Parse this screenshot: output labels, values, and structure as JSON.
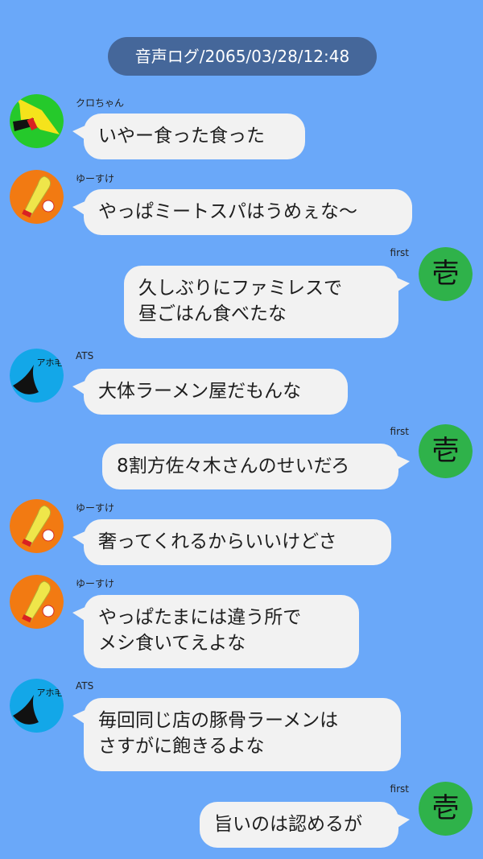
{
  "header": {
    "label": "音声ログ/2065/03/28/12:48"
  },
  "users": {
    "kuro": "クロちゃん",
    "yusuke": "ゆーすけ",
    "first": "first",
    "ats": "ATS"
  },
  "avatars": {
    "first_glyph": "壱",
    "ats_text": "アホ毛"
  },
  "messages": [
    {
      "speaker": "クロちゃん",
      "lines": [
        "いやー食った食った"
      ]
    },
    {
      "speaker": "ゆーすけ",
      "lines": [
        "やっぱミートスパはうめぇな〜"
      ]
    },
    {
      "speaker": "first",
      "lines": [
        "久しぶりにファミレスで",
        "昼ごはん食べたな"
      ]
    },
    {
      "speaker": "ATS",
      "lines": [
        "大体ラーメン屋だもんな"
      ]
    },
    {
      "speaker": "first",
      "lines": [
        "8割方佐々木さんのせいだろ"
      ]
    },
    {
      "speaker": "ゆーすけ",
      "lines": [
        "奢ってくれるからいいけどさ"
      ]
    },
    {
      "speaker": "ゆーすけ",
      "lines": [
        "やっぱたまには違う所で",
        "メシ食いてえよな"
      ]
    },
    {
      "speaker": "ATS",
      "lines": [
        "毎回同じ店の豚骨ラーメンは",
        "さすがに飽きるよな"
      ]
    },
    {
      "speaker": "first",
      "lines": [
        "旨いのは認めるが"
      ]
    }
  ],
  "colors": {
    "background": "#6AA8F9",
    "header_pill": "#45679A",
    "bubble": "#F2F2F2",
    "avatar_first": "#2FB24A",
    "avatar_kuro": "#25C92B",
    "avatar_yusuke": "#F27A12",
    "avatar_ats": "#13A7E8"
  }
}
